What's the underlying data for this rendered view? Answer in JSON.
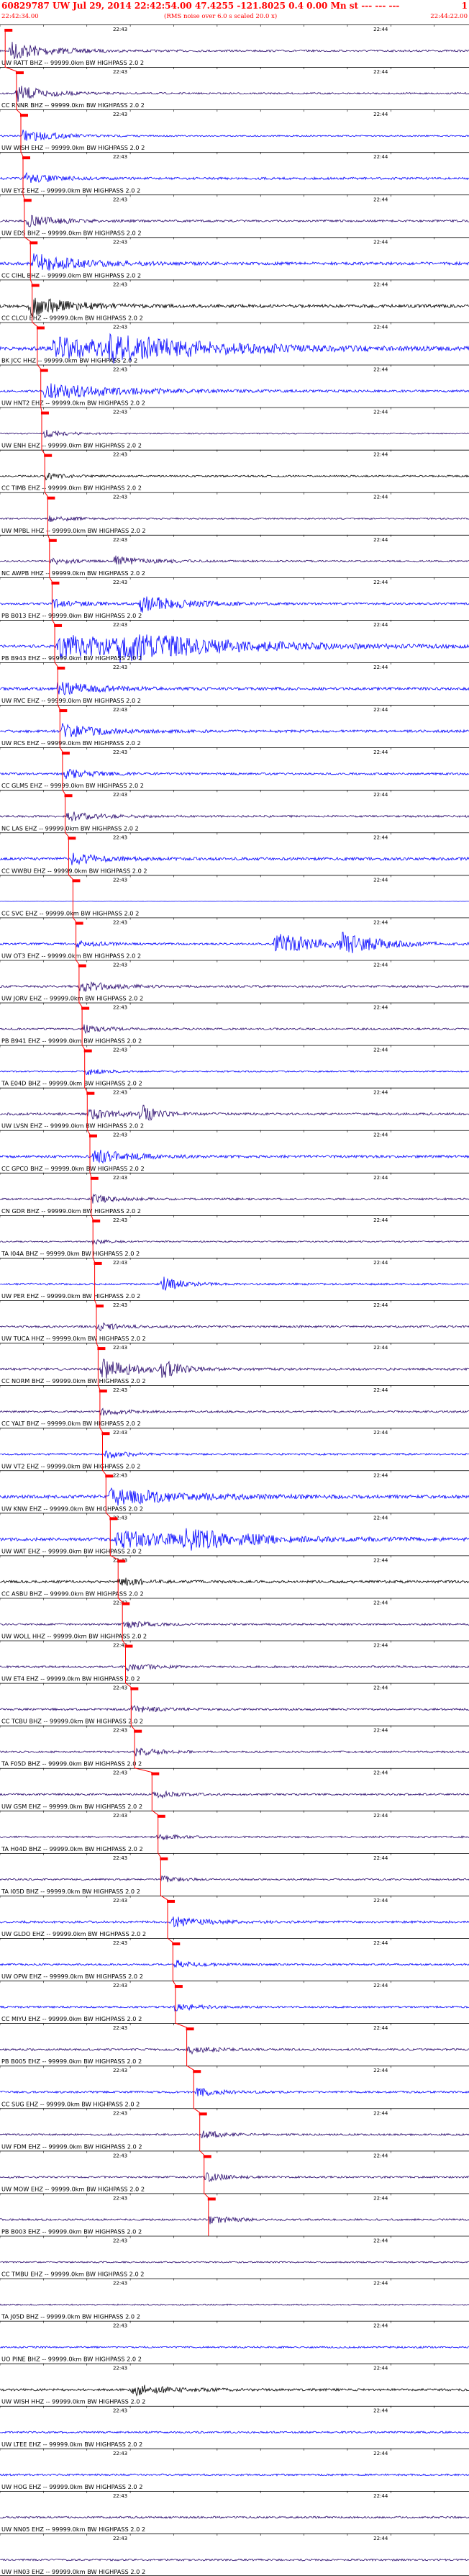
{
  "header": {
    "title": "60829787 UW Jul 29, 2014 22:42:54.00   47.4255  -121.8025  0.4 0.00 Mn st --- --- ---",
    "page_number": "1",
    "start_time": "22:42:34.00",
    "scale_note": "(RMS noise over 6.0 s scaled 20.0 x)",
    "end_time": "22:44:22.00"
  },
  "chart_data": {
    "type": "line",
    "title": "60829787 UW Jul 29, 2014 22:42:54.00   47.4255  -121.8025  0.4 0.00 Mn st --- --- ---",
    "x_start": "22:42:34.00",
    "x_end": "22:44:22.00",
    "duration_s": 108,
    "tick_labels": [
      "22:43",
      "22:44"
    ],
    "tick_offsets_s": [
      26,
      86
    ],
    "filter_note": "HIGHPASS  2.0  2",
    "colors": {
      "red": "#ff0000",
      "black": "#000000",
      "blue": "#0000ff",
      "indigo": "#2a0a6e"
    },
    "traces": [
      {
        "label": "UW RATT BHZ -- 99999.0km BW  HIGHPASS  2.0  2",
        "color": "indigo",
        "pick_s": 1.2,
        "events": [
          [
            2,
            10,
            14
          ]
        ],
        "noise": 1.3
      },
      {
        "label": "CC RNNR BHZ -- 99999.0km BW  HIGHPASS  2.0  2",
        "color": "indigo",
        "pick_s": 3.8,
        "events": [
          [
            3.5,
            8,
            12
          ]
        ],
        "noise": 1.1
      },
      {
        "label": "UW WISH EHZ -- 99999.0km BW  HIGHPASS  2.0  2",
        "color": "blue",
        "pick_s": 4.8,
        "events": [
          [
            5,
            9,
            9
          ]
        ],
        "noise": 1.0
      },
      {
        "label": "UW EYZ EHZ -- 99999.0km BW  HIGHPASS  2.0  2",
        "color": "blue",
        "pick_s": 5.3,
        "events": [
          [
            5.5,
            8,
            7
          ]
        ],
        "noise": 1.6
      },
      {
        "label": "UW EDS BHZ -- 99999.0km BW  HIGHPASS  2.0  2",
        "color": "indigo",
        "pick_s": 5.6,
        "events": [
          [
            6,
            9,
            8
          ]
        ],
        "noise": 1.4
      },
      {
        "label": "CC CIHL BHZ -- 99999.0km BW  HIGHPASS  2.0  2",
        "color": "blue",
        "pick_s": 7.0,
        "events": [
          [
            7,
            12,
            14
          ]
        ],
        "noise": 2.0
      },
      {
        "label": "CC CLCU EHZ -- 99999.0km BW  HIGHPASS  2.0  2",
        "color": "black",
        "pick_s": 7.4,
        "events": [
          [
            6.5,
            10,
            15
          ]
        ],
        "noise": 2.2
      },
      {
        "label": "BK JCC HHZ -- 99999.0km BW  HIGHPASS  2.0  2",
        "color": "blue",
        "pick_s": 8.6,
        "events": [
          [
            12,
            30,
            15
          ],
          [
            25,
            25,
            12
          ]
        ],
        "noise": 2.5
      },
      {
        "label": "UW HNT2 EHZ -- 99999.0km BW  HIGHPASS  2.0  2",
        "color": "blue",
        "pick_s": 9.4,
        "events": [
          [
            10,
            20,
            12
          ]
        ],
        "noise": 1.5
      },
      {
        "label": "UW ENH EHZ -- 99999.0km BW  HIGHPASS  2.0  2",
        "color": "indigo",
        "pick_s": 9.6,
        "events": [
          [
            10,
            6,
            6
          ]
        ],
        "noise": 0.8
      },
      {
        "label": "CC TIMB EHZ -- 99999.0km BW  HIGHPASS  2.0  2",
        "color": "black",
        "pick_s": 10.3,
        "events": [
          [
            10.3,
            5,
            5
          ]
        ],
        "noise": 1.2
      },
      {
        "label": "UW MPBL HHZ -- 99999.0km BW  HIGHPASS  2.0  2",
        "color": "indigo",
        "pick_s": 11.0,
        "events": [
          [
            11,
            6,
            5
          ]
        ],
        "noise": 1.0
      },
      {
        "label": "NC AWPB HHZ -- 99999.0km BW  HIGHPASS  2.0  2",
        "color": "indigo",
        "pick_s": 11.4,
        "events": [
          [
            11.5,
            6,
            5
          ],
          [
            26,
            10,
            7
          ]
        ],
        "noise": 1.1
      },
      {
        "label": "PB B013 EHZ -- 99999.0km BW  HIGHPASS  2.0  2",
        "color": "blue",
        "pick_s": 12.0,
        "events": [
          [
            12,
            8,
            6
          ],
          [
            32,
            12,
            12
          ]
        ],
        "noise": 1.4
      },
      {
        "label": "PB B943 EHZ -- 99999.0km BW  HIGHPASS  2.0  2",
        "color": "blue",
        "pick_s": 12.6,
        "events": [
          [
            13,
            30,
            16
          ],
          [
            27,
            25,
            14
          ]
        ],
        "noise": 2.0
      },
      {
        "label": "UW RVC EHZ -- 99999.0km BW  HIGHPASS  2.0  2",
        "color": "blue",
        "pick_s": 13.3,
        "events": [
          [
            13,
            10,
            10
          ]
        ],
        "noise": 2.0
      },
      {
        "label": "UW RCS EHZ -- 99999.0km BW  HIGHPASS  2.0  2",
        "color": "blue",
        "pick_s": 13.8,
        "events": [
          [
            14,
            10,
            10
          ]
        ],
        "noise": 1.8
      },
      {
        "label": "CC GLMS EHZ -- 99999.0km BW  HIGHPASS  2.0  2",
        "color": "blue",
        "pick_s": 14.4,
        "events": [
          [
            14.5,
            8,
            7
          ]
        ],
        "noise": 1.4
      },
      {
        "label": "NC LAS EHZ -- 99999.0km BW  HIGHPASS  2.0  2",
        "color": "indigo",
        "pick_s": 15.0,
        "events": [
          [
            15,
            8,
            7
          ]
        ],
        "noise": 1.4
      },
      {
        "label": "CC WWBU EHZ -- 99999.0km BW  HIGHPASS  2.0  2",
        "color": "blue",
        "pick_s": 15.8,
        "events": [
          [
            16,
            8,
            8
          ]
        ],
        "noise": 2.0
      },
      {
        "label": "CC SVC EHZ -- 99999.0km BW  HIGHPASS  2.0  2",
        "color": "blue",
        "pick_s": 16.8,
        "events": [],
        "noise": 0.15
      },
      {
        "label": "UW OT3 EHZ -- 99999.0km BW  HIGHPASS  2.0  2",
        "color": "blue",
        "pick_s": 17.5,
        "events": [
          [
            17.5,
            6,
            5
          ],
          [
            63,
            12,
            16
          ],
          [
            78,
            10,
            14
          ]
        ],
        "noise": 1.4
      },
      {
        "label": "UW JORV EHZ -- 99999.0km BW  HIGHPASS  2.0  2",
        "color": "indigo",
        "pick_s": 18.2,
        "events": [
          [
            18,
            8,
            8
          ]
        ],
        "noise": 1.5
      },
      {
        "label": "PB B941 EHZ -- 99999.0km BW  HIGHPASS  2.0  2",
        "color": "indigo",
        "pick_s": 18.9,
        "events": [
          [
            19,
            6,
            6
          ]
        ],
        "noise": 1.3
      },
      {
        "label": "TA E04D BHZ -- 99999.0km BW  HIGHPASS  2.0  2",
        "color": "blue",
        "pick_s": 19.5,
        "events": [
          [
            19.5,
            5,
            5
          ]
        ],
        "noise": 1.0
      },
      {
        "label": "UW LVSN EHZ -- 99999.0km BW  HIGHPASS  2.0  2",
        "color": "indigo",
        "pick_s": 20.1,
        "events": [
          [
            20,
            8,
            8
          ],
          [
            32,
            4,
            14
          ]
        ],
        "noise": 1.6
      },
      {
        "label": "CC GPCO BHZ -- 99999.0km BW  HIGHPASS  2.0  2",
        "color": "blue",
        "pick_s": 20.7,
        "events": [
          [
            21,
            10,
            10
          ]
        ],
        "noise": 1.8
      },
      {
        "label": "CN GDR BHZ -- 99999.0km BW  HIGHPASS  2.0  2",
        "color": "indigo",
        "pick_s": 21.0,
        "events": [
          [
            21,
            6,
            6
          ]
        ],
        "noise": 1.4
      },
      {
        "label": "TA I04A BHZ -- 99999.0km BW  HIGHPASS  2.0  2",
        "color": "indigo",
        "pick_s": 21.4,
        "events": [
          [
            21,
            4,
            4
          ]
        ],
        "noise": 1.0
      },
      {
        "label": "UW PER EHZ -- 99999.0km BW  HIGHPASS  2.0  2",
        "color": "blue",
        "pick_s": 21.8,
        "events": [
          [
            37,
            5,
            12
          ]
        ],
        "noise": 1.3
      },
      {
        "label": "UW TUCA HHZ -- 99999.0km BW  HIGHPASS  2.0  2",
        "color": "indigo",
        "pick_s": 22.2,
        "events": [
          [
            22,
            6,
            6
          ]
        ],
        "noise": 1.4
      },
      {
        "label": "CC NORM BHZ -- 99999.0km BW  HIGHPASS  2.0  2",
        "color": "indigo",
        "pick_s": 22.6,
        "events": [
          [
            23,
            10,
            14
          ],
          [
            37,
            4,
            14
          ]
        ],
        "noise": 1.6
      },
      {
        "label": "CC YALT BHZ -- 99999.0km BW  HIGHPASS  2.0  2",
        "color": "indigo",
        "pick_s": 23.0,
        "events": [
          [
            23,
            6,
            6
          ]
        ],
        "noise": 1.3
      },
      {
        "label": "UW VT2 EHZ -- 99999.0km BW  HIGHPASS  2.0  2",
        "color": "blue",
        "pick_s": 23.6,
        "events": [
          [
            24,
            6,
            6
          ]
        ],
        "noise": 1.3
      },
      {
        "label": "UW KNW EHZ -- 99999.0km BW  HIGHPASS  2.0  2",
        "color": "blue",
        "pick_s": 24.4,
        "events": [
          [
            25,
            20,
            12
          ]
        ],
        "noise": 2.2
      },
      {
        "label": "UW WAT EHZ -- 99999.0km BW  HIGHPASS  2.0  2",
        "color": "blue",
        "pick_s": 25.4,
        "events": [
          [
            26,
            20,
            12
          ],
          [
            42,
            18,
            12
          ]
        ],
        "noise": 2.2
      },
      {
        "label": "CC ASBU BHZ -- 99999.0km BW  HIGHPASS  2.0  2",
        "color": "black",
        "pick_s": 27.2,
        "events": [
          [
            27,
            6,
            6
          ]
        ],
        "noise": 1.8
      },
      {
        "label": "UW WOLL HHZ -- 99999.0km BW  HIGHPASS  2.0  2",
        "color": "indigo",
        "pick_s": 28.2,
        "events": [
          [
            28,
            6,
            6
          ]
        ],
        "noise": 1.3
      },
      {
        "label": "UW ET4 EHZ -- 99999.0km BW  HIGHPASS  2.0  2",
        "color": "indigo",
        "pick_s": 28.9,
        "events": [
          [
            29,
            6,
            6
          ]
        ],
        "noise": 1.4
      },
      {
        "label": "CC TCBU BHZ -- 99999.0km BW  HIGHPASS  2.0  2",
        "color": "indigo",
        "pick_s": 30.2,
        "events": [
          [
            30,
            6,
            6
          ]
        ],
        "noise": 1.4
      },
      {
        "label": "TA F05D BHZ -- 99999.0km BW  HIGHPASS  2.0  2",
        "color": "indigo",
        "pick_s": 31.0,
        "events": [
          [
            31,
            6,
            6
          ]
        ],
        "noise": 1.3
      },
      {
        "label": "UW GSM EHZ -- 99999.0km BW  HIGHPASS  2.0  2",
        "color": "indigo",
        "pick_s": 35.0,
        "events": [
          [
            35,
            6,
            6
          ]
        ],
        "noise": 1.3
      },
      {
        "label": "TA H04D BHZ -- 99999.0km BW  HIGHPASS  2.0  2",
        "color": "indigo",
        "pick_s": 36.4,
        "events": [
          [
            36,
            5,
            5
          ]
        ],
        "noise": 1.2
      },
      {
        "label": "TA I05D BHZ -- 99999.0km BW  HIGHPASS  2.0  2",
        "color": "indigo",
        "pick_s": 37.0,
        "events": [
          [
            37,
            5,
            5
          ]
        ],
        "noise": 1.2
      },
      {
        "label": "UW GLDO EHZ -- 99999.0km BW  HIGHPASS  2.0  2",
        "color": "blue",
        "pick_s": 38.6,
        "events": [
          [
            39,
            8,
            8
          ]
        ],
        "noise": 1.6
      },
      {
        "label": "UW OPW EHZ -- 99999.0km BW  HIGHPASS  2.0  2",
        "color": "blue",
        "pick_s": 39.8,
        "events": [
          [
            40,
            6,
            6
          ]
        ],
        "noise": 1.3
      },
      {
        "label": "CC MIYU EHZ -- 99999.0km BW  HIGHPASS  2.0  2",
        "color": "blue",
        "pick_s": 40.4,
        "events": [
          [
            40,
            6,
            6
          ]
        ],
        "noise": 1.3
      },
      {
        "label": "PB B005 EHZ -- 99999.0km BW  HIGHPASS  2.0  2",
        "color": "indigo",
        "pick_s": 43.0,
        "events": [
          [
            43,
            6,
            6
          ]
        ],
        "noise": 1.4
      },
      {
        "label": "CC SUG EHZ -- 99999.0km BW  HIGHPASS  2.0  2",
        "color": "blue",
        "pick_s": 44.6,
        "events": [
          [
            45,
            6,
            6
          ]
        ],
        "noise": 1.4
      },
      {
        "label": "UW FDM EHZ -- 99999.0km BW  HIGHPASS  2.0  2",
        "color": "indigo",
        "pick_s": 46.0,
        "events": [
          [
            46,
            6,
            6
          ]
        ],
        "noise": 1.3
      },
      {
        "label": "UW MOW EHZ -- 99999.0km BW  HIGHPASS  2.0  2",
        "color": "indigo",
        "pick_s": 47.0,
        "events": [
          [
            47,
            6,
            6
          ]
        ],
        "noise": 1.3
      },
      {
        "label": "PB B003 EHZ -- 99999.0km BW  HIGHPASS  2.0  2",
        "color": "indigo",
        "pick_s": 48.0,
        "events": [
          [
            48,
            6,
            6
          ]
        ],
        "noise": 1.3
      },
      {
        "label": "CC TMBU EHZ -- 99999.0km BW  HIGHPASS  2.0  2",
        "color": "indigo",
        "pick_s": null,
        "events": [],
        "noise": 1.0
      },
      {
        "label": "TA J05D BHZ -- 99999.0km BW  HIGHPASS  2.0  2",
        "color": "indigo",
        "pick_s": null,
        "events": [],
        "noise": 1.0
      },
      {
        "label": "UO PINE BHZ -- 99999.0km BW  HIGHPASS  2.0  2",
        "color": "blue",
        "pick_s": null,
        "events": [],
        "noise": 1.2
      },
      {
        "label": "UW WISH HHZ -- 99999.0km BW  HIGHPASS  2.0  2",
        "color": "black",
        "pick_s": null,
        "events": [
          [
            30,
            10,
            8
          ]
        ],
        "noise": 1.6
      },
      {
        "label": "UW LTEE EHZ -- 99999.0km BW  HIGHPASS  2.0  2",
        "color": "blue",
        "pick_s": null,
        "events": [],
        "noise": 1.3
      },
      {
        "label": "UW HOG EHZ -- 99999.0km BW  HIGHPASS  2.0  2",
        "color": "blue",
        "pick_s": null,
        "events": [],
        "noise": 1.3
      },
      {
        "label": "UW NN05 EHZ -- 99999.0km BW  HIGHPASS  2.0  2",
        "color": "indigo",
        "pick_s": null,
        "events": [],
        "noise": 1.3
      },
      {
        "label": "UW HN03 EHZ -- 99999.0km BW  HIGHPASS  2.0  2",
        "color": "indigo",
        "pick_s": null,
        "events": [],
        "noise": 1.3
      }
    ]
  }
}
